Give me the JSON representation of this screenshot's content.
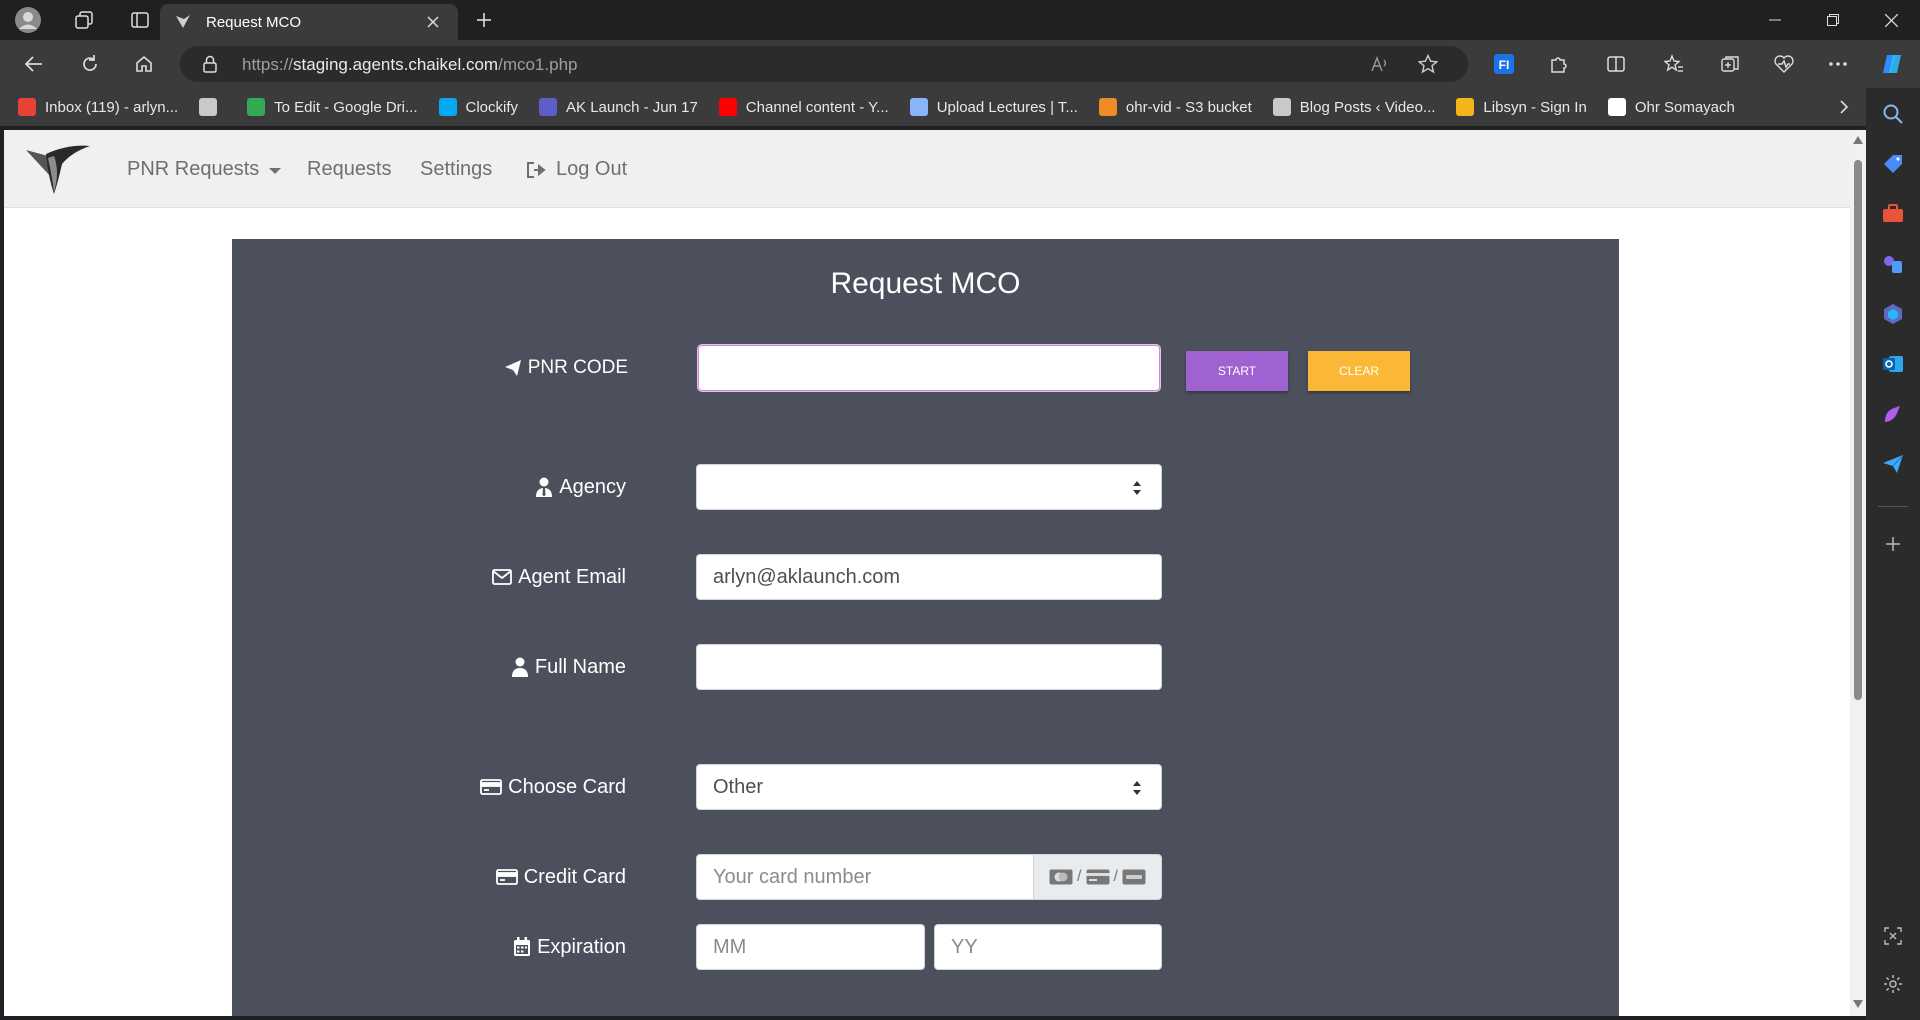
{
  "browser": {
    "tab_title": "Request MCO",
    "url_prefix": "https://",
    "url_host": "staging.agents.chaikel.com",
    "url_path": "/mco1.php",
    "bookmarks": [
      {
        "label": "Inbox (119) - arlyn...",
        "icon": "gmail-icon",
        "color": "#ea4335"
      },
      {
        "label": "",
        "icon": "lecture-library-icon",
        "color": "#c9c9c9"
      },
      {
        "label": "To Edit - Google Dri...",
        "icon": "google-drive-icon",
        "color": "#34a853"
      },
      {
        "label": "Clockify",
        "icon": "clockify-icon",
        "color": "#03a9f4"
      },
      {
        "label": "AK Launch - Jun 17",
        "icon": "ak-launch-icon",
        "color": "#5b5fc7"
      },
      {
        "label": "Channel content - Y...",
        "icon": "youtube-icon",
        "color": "#ff0000"
      },
      {
        "label": "Upload Lectures | T...",
        "icon": "upload-icon",
        "color": "#8ab4f8"
      },
      {
        "label": "ohr-vid - S3 bucket",
        "icon": "aws-s3-icon",
        "color": "#f08a24"
      },
      {
        "label": "Blog Posts ‹ Video...",
        "icon": "wordpress-lib-icon",
        "color": "#c9c9c9"
      },
      {
        "label": "Libsyn - Sign In",
        "icon": "libsyn-icon",
        "color": "#f2b61a"
      },
      {
        "label": "Ohr Somayach",
        "icon": "ohr-somayach-icon",
        "color": "#ffffff"
      }
    ]
  },
  "site": {
    "nav": {
      "pnr_requests": "PNR Requests",
      "requests": "Requests",
      "settings": "Settings",
      "logout": "Log Out"
    }
  },
  "form": {
    "title": "Request MCO",
    "pnr_label": "PNR CODE",
    "pnr_value": "",
    "start_label": "START",
    "clear_label": "CLEAR",
    "agency_label": "Agency",
    "agency_value": "",
    "agent_email_label": "Agent Email",
    "agent_email_value": "arlyn@aklaunch.com",
    "full_name_label": "Full Name",
    "full_name_value": "",
    "choose_card_label": "Choose Card",
    "choose_card_value": "Other",
    "credit_card_label": "Credit Card",
    "credit_card_placeholder": "Your card number",
    "expiration_label": "Expiration",
    "exp_month_placeholder": "MM",
    "exp_year_placeholder": "YY"
  },
  "colors": {
    "card_bg": "#4b505c",
    "start_button": "#a061d1",
    "clear_button": "#fbb836",
    "nav_bg": "#f0f0f0"
  }
}
